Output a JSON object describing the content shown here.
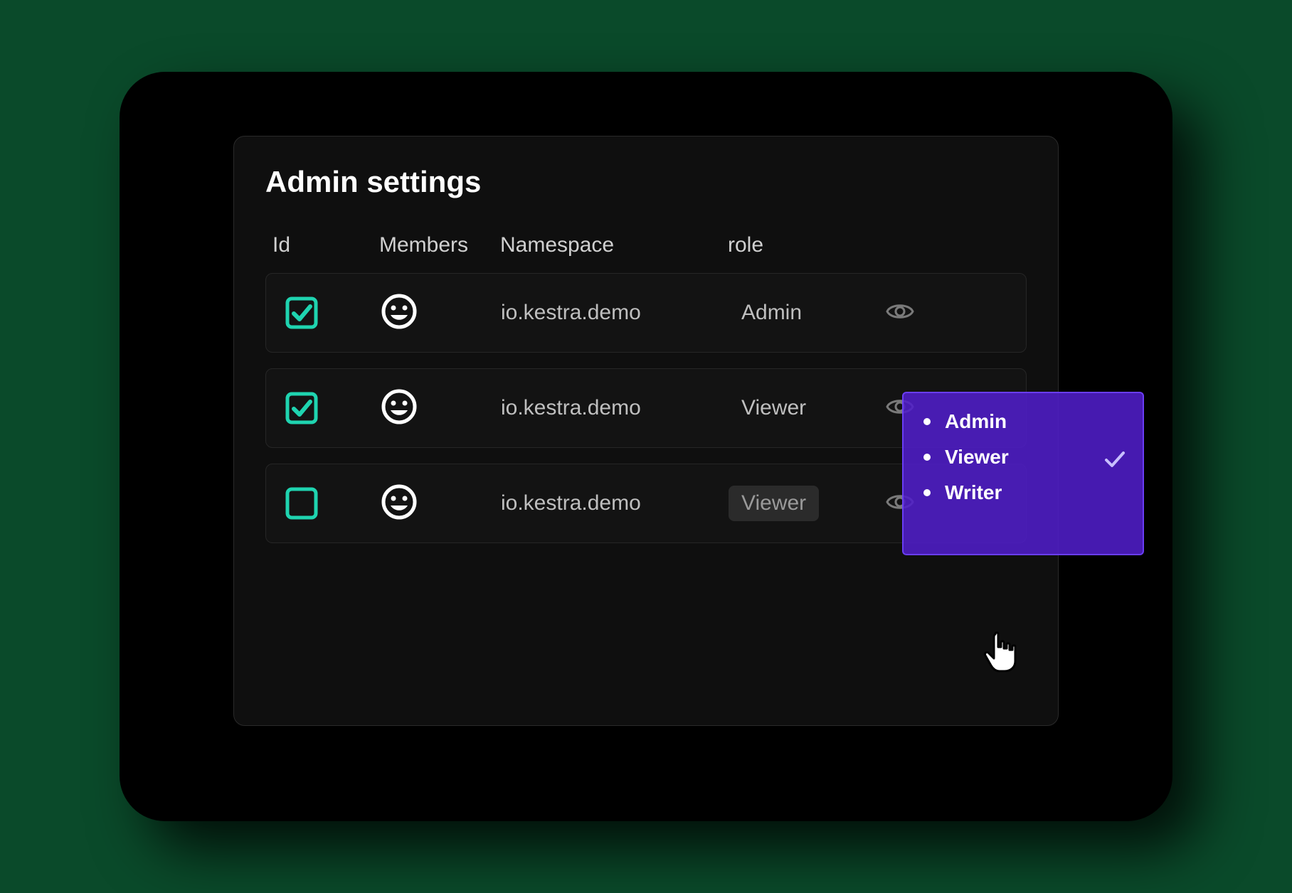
{
  "title": "Admin settings",
  "columns": {
    "id": "Id",
    "members": "Members",
    "namespace": "Namespace",
    "role": "role"
  },
  "rows": [
    {
      "checked": true,
      "namespace": "io.kestra.demo",
      "role": "Admin"
    },
    {
      "checked": true,
      "namespace": "io.kestra.demo",
      "role": "Viewer"
    },
    {
      "checked": false,
      "namespace": "io.kestra.demo",
      "role": "Viewer"
    }
  ],
  "dropdown": {
    "options": [
      "Admin",
      "Viewer",
      "Writer"
    ],
    "selected": "Viewer"
  },
  "colors": {
    "accent_teal": "#1fd4b0",
    "dropdown_purple": "#501ec8"
  }
}
